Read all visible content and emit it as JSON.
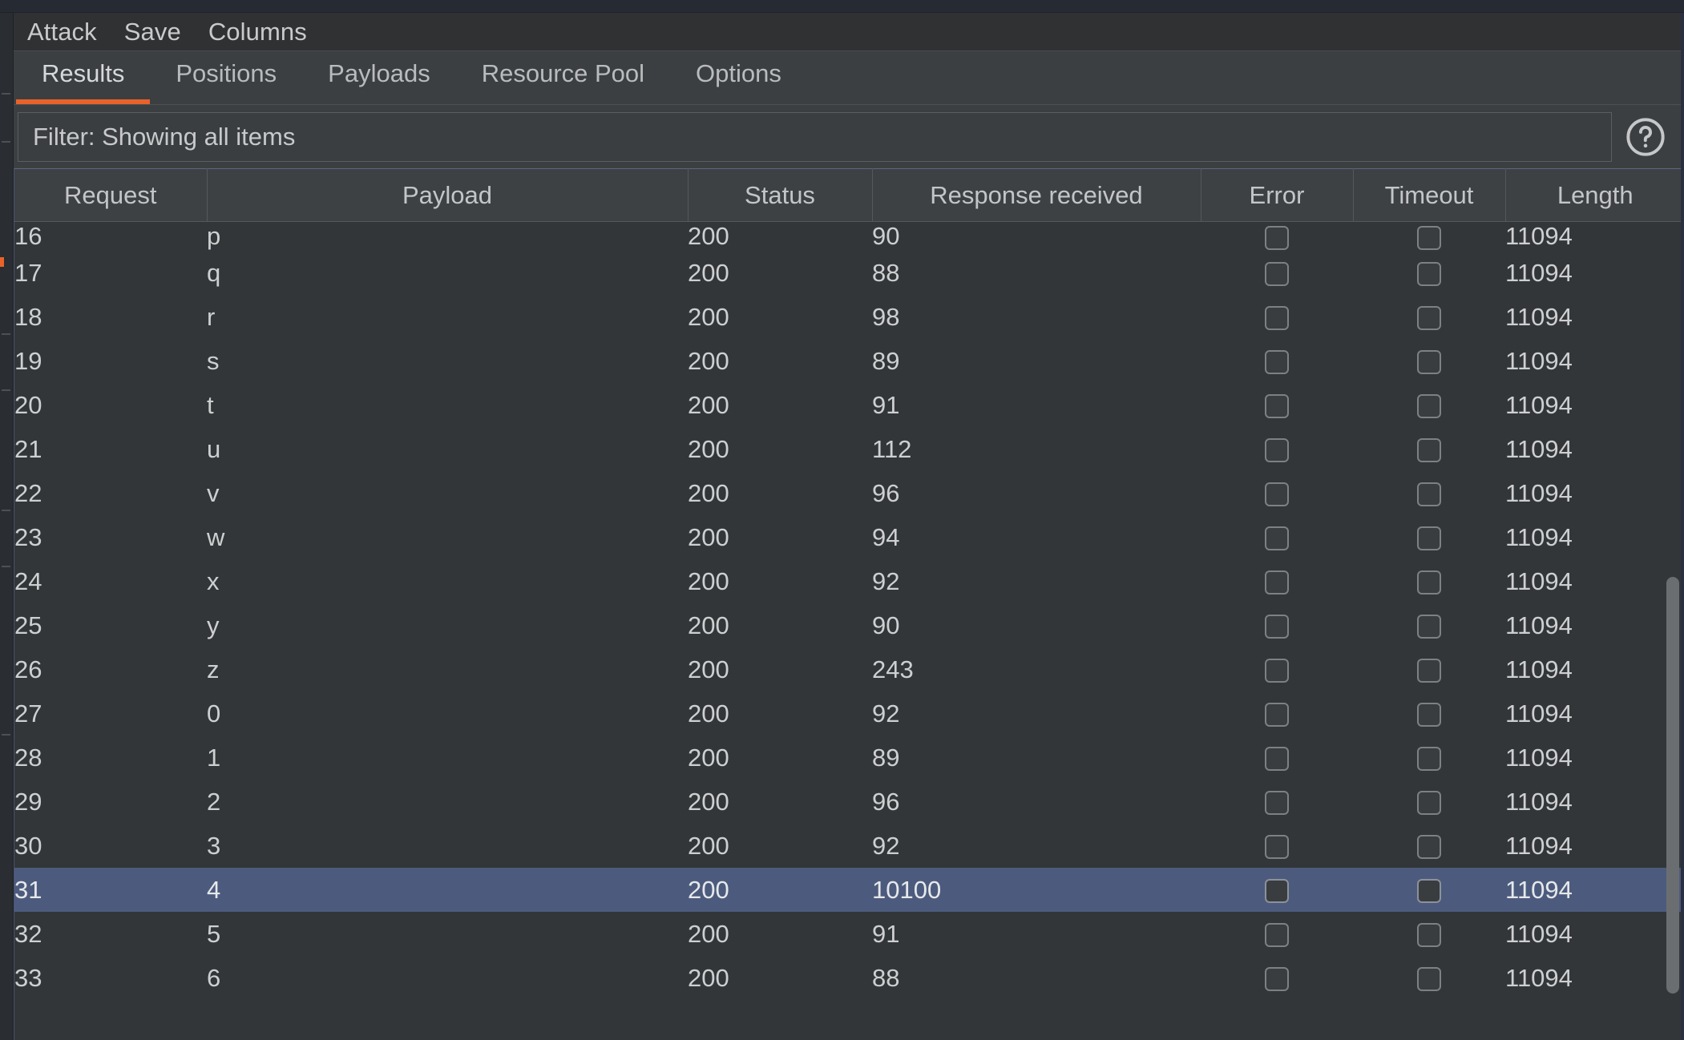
{
  "menubar": {
    "items": [
      {
        "label": "Attack",
        "name": "menu-attack"
      },
      {
        "label": "Save",
        "name": "menu-save"
      },
      {
        "label": "Columns",
        "name": "menu-columns"
      }
    ]
  },
  "tabs": {
    "active": "Results",
    "items": [
      {
        "label": "Results",
        "name": "tab-results",
        "active": true
      },
      {
        "label": "Positions",
        "name": "tab-positions",
        "active": false
      },
      {
        "label": "Payloads",
        "name": "tab-payloads",
        "active": false
      },
      {
        "label": "Resource Pool",
        "name": "tab-resource-pool",
        "active": false
      },
      {
        "label": "Options",
        "name": "tab-options",
        "active": false
      }
    ]
  },
  "filter": {
    "text": "Filter: Showing all items",
    "placeholder": "Filter: Showing all items",
    "help_icon": "question-circle-icon"
  },
  "table": {
    "columns": [
      {
        "key": "request",
        "label": "Request"
      },
      {
        "key": "payload",
        "label": "Payload"
      },
      {
        "key": "status",
        "label": "Status"
      },
      {
        "key": "response",
        "label": "Response received"
      },
      {
        "key": "error",
        "label": "Error"
      },
      {
        "key": "timeout",
        "label": "Timeout"
      },
      {
        "key": "length",
        "label": "Length"
      }
    ],
    "selected_request": "31",
    "rows": [
      {
        "request": "16",
        "payload": "p",
        "status": "200",
        "response": "90",
        "error": false,
        "timeout": false,
        "length": "11094",
        "clipped": true,
        "selected": false
      },
      {
        "request": "17",
        "payload": "q",
        "status": "200",
        "response": "88",
        "error": false,
        "timeout": false,
        "length": "11094",
        "clipped": false,
        "selected": false
      },
      {
        "request": "18",
        "payload": "r",
        "status": "200",
        "response": "98",
        "error": false,
        "timeout": false,
        "length": "11094",
        "clipped": false,
        "selected": false
      },
      {
        "request": "19",
        "payload": "s",
        "status": "200",
        "response": "89",
        "error": false,
        "timeout": false,
        "length": "11094",
        "clipped": false,
        "selected": false
      },
      {
        "request": "20",
        "payload": "t",
        "status": "200",
        "response": "91",
        "error": false,
        "timeout": false,
        "length": "11094",
        "clipped": false,
        "selected": false
      },
      {
        "request": "21",
        "payload": "u",
        "status": "200",
        "response": "112",
        "error": false,
        "timeout": false,
        "length": "11094",
        "clipped": false,
        "selected": false
      },
      {
        "request": "22",
        "payload": "v",
        "status": "200",
        "response": "96",
        "error": false,
        "timeout": false,
        "length": "11094",
        "clipped": false,
        "selected": false
      },
      {
        "request": "23",
        "payload": "w",
        "status": "200",
        "response": "94",
        "error": false,
        "timeout": false,
        "length": "11094",
        "clipped": false,
        "selected": false
      },
      {
        "request": "24",
        "payload": "x",
        "status": "200",
        "response": "92",
        "error": false,
        "timeout": false,
        "length": "11094",
        "clipped": false,
        "selected": false
      },
      {
        "request": "25",
        "payload": "y",
        "status": "200",
        "response": "90",
        "error": false,
        "timeout": false,
        "length": "11094",
        "clipped": false,
        "selected": false
      },
      {
        "request": "26",
        "payload": "z",
        "status": "200",
        "response": "243",
        "error": false,
        "timeout": false,
        "length": "11094",
        "clipped": false,
        "selected": false
      },
      {
        "request": "27",
        "payload": "0",
        "status": "200",
        "response": "92",
        "error": false,
        "timeout": false,
        "length": "11094",
        "clipped": false,
        "selected": false
      },
      {
        "request": "28",
        "payload": "1",
        "status": "200",
        "response": "89",
        "error": false,
        "timeout": false,
        "length": "11094",
        "clipped": false,
        "selected": false
      },
      {
        "request": "29",
        "payload": "2",
        "status": "200",
        "response": "96",
        "error": false,
        "timeout": false,
        "length": "11094",
        "clipped": false,
        "selected": false
      },
      {
        "request": "30",
        "payload": "3",
        "status": "200",
        "response": "92",
        "error": false,
        "timeout": false,
        "length": "11094",
        "clipped": false,
        "selected": false
      },
      {
        "request": "31",
        "payload": "4",
        "status": "200",
        "response": "10100",
        "error": false,
        "timeout": false,
        "length": "11094",
        "clipped": false,
        "selected": true
      },
      {
        "request": "32",
        "payload": "5",
        "status": "200",
        "response": "91",
        "error": false,
        "timeout": false,
        "length": "11094",
        "clipped": false,
        "selected": false
      },
      {
        "request": "33",
        "payload": "6",
        "status": "200",
        "response": "88",
        "error": false,
        "timeout": false,
        "length": "11094",
        "clipped": false,
        "selected": false
      }
    ]
  },
  "colors": {
    "accent": "#e8622a",
    "selection": "#4c5b7d",
    "panel_bg": "#3c3f41",
    "table_bg": "#333638",
    "menubar_bg": "#2f3133",
    "text": "#cdcfd1"
  },
  "scrollbar": {
    "name": "vertical-scrollbar"
  }
}
